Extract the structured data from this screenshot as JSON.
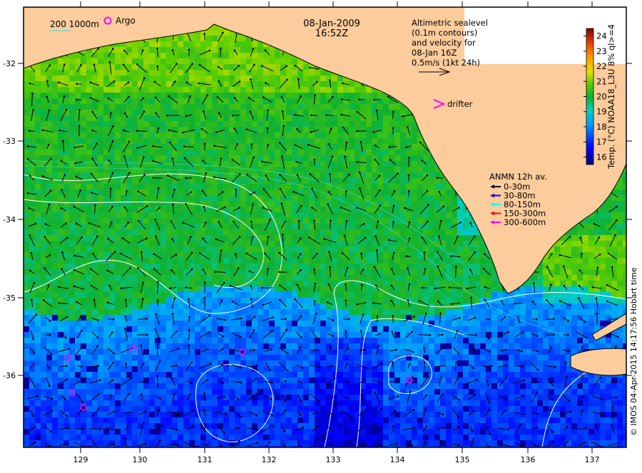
{
  "map": {
    "date": "08-Jan-2009",
    "time": "16:52Z",
    "isobath_label": "200  1000m",
    "argo_label": "Argo",
    "altimetry_note": [
      "Altimetric sealevel",
      "(0.1m contours)",
      "and velocity for",
      "08-Jan 16Z",
      "0.5m/s (1kt 24h)"
    ],
    "drifter_label": "drifter",
    "mooring_legend": {
      "title": "ANMN 12h av.",
      "items": [
        {
          "label": "0-30m",
          "color": "#000000"
        },
        {
          "label": "30-80m",
          "color": "#0000ff"
        },
        {
          "label": "80-150m",
          "color": "#00ffff"
        },
        {
          "label": "150-300m",
          "color": "#ff0000"
        },
        {
          "label": "300-600m",
          "color": "#ff00ff"
        }
      ]
    },
    "colorbar": {
      "title": "Temp. (°C) NOAA18_L3U 8% ql>=4",
      "ticks": [
        "16",
        "17",
        "18",
        "19",
        "20",
        "21",
        "22",
        "23",
        "24"
      ],
      "range": [
        15.5,
        24.5
      ]
    },
    "credit": "© IMOS 04-Apr-2015 14:17:56 Hobart time",
    "lon_ticks": [
      "129",
      "130",
      "131",
      "132",
      "133",
      "134",
      "135",
      "136",
      "137"
    ],
    "lat_ticks": [
      "-32",
      "-33",
      "-34",
      "-35",
      "-36"
    ],
    "colors": {
      "land": "#fccc9c",
      "argo": "#ff00ff",
      "contour": "#ffffff"
    }
  }
}
